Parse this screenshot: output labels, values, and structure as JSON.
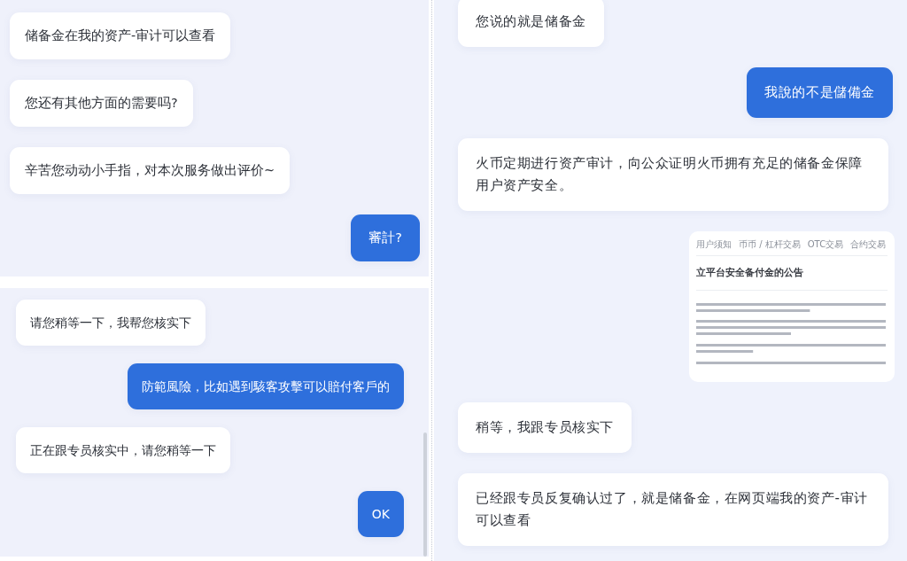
{
  "left_top_chat": {
    "messages": [
      {
        "kind": "received",
        "text": "储备金在我的资产-审计可以查看"
      },
      {
        "kind": "received",
        "text": "您还有其他方面的需要吗?"
      },
      {
        "kind": "received",
        "text": "辛苦您动动小手指，对本次服务做出评价~"
      },
      {
        "kind": "sent",
        "text": "審計?"
      }
    ]
  },
  "left_bottom_chat": {
    "messages": [
      {
        "kind": "received",
        "text": "请您稍等一下，我帮您核实下"
      },
      {
        "kind": "sent",
        "text": "防範風險，比如遇到駭客攻擊可以賠付客戶的"
      },
      {
        "kind": "received",
        "text": "正在跟专员核实中，请您稍等一下"
      },
      {
        "kind": "sent",
        "text": "OK"
      }
    ]
  },
  "right_chat": {
    "messages": [
      {
        "kind": "received",
        "text": "您说的就是储备金"
      },
      {
        "kind": "sent",
        "text": "我說的不是儲備金"
      },
      {
        "kind": "received",
        "text": "火币定期进行资产审计，向公众证明火币拥有充足的储备金保障用户资产安全。"
      },
      {
        "kind": "screenshot",
        "tabs": [
          "用户须知",
          "币币 / 杠杆交易",
          "OTC交易",
          "合约交易"
        ],
        "title": "立平台安全备付金的公告"
      },
      {
        "kind": "received",
        "text": "稍等，我跟专员核实下"
      },
      {
        "kind": "received",
        "text": "已经跟专员反复确认过了，就是储备金，在网页端我的资产-审计可以查看"
      }
    ]
  }
}
